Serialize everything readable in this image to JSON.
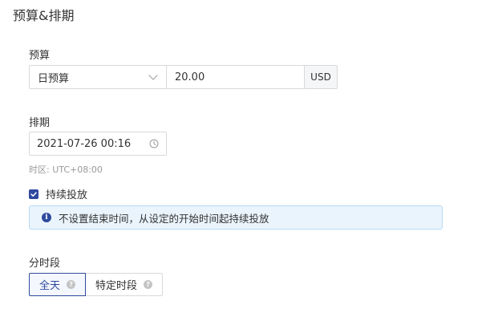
{
  "section": {
    "title": "预算&排期"
  },
  "budget": {
    "label": "预算",
    "type_selected": "日预算",
    "amount": "20.00",
    "currency": "USD",
    "icons": {
      "dropdown": "chevron-down-icon"
    }
  },
  "schedule": {
    "label": "排期",
    "start_datetime": "2021-07-26 00:16",
    "timezone": "时区: UTC+08:00",
    "icons": {
      "picker": "clock-icon"
    }
  },
  "continuous": {
    "label": "持续投放",
    "checked": true,
    "notice": "不设置结束时间，从设定的开始时间起持续投放"
  },
  "time_segment": {
    "label": "分时段",
    "options": [
      {
        "label": "全天",
        "selected": true
      },
      {
        "label": "特定时段",
        "selected": false
      }
    ]
  },
  "colors": {
    "accent": "#2e4a9e",
    "border": "#d9d9d9",
    "info_bg": "#eaf4fc",
    "info_border": "#b8d8f2",
    "muted_text": "#9a9a9a"
  }
}
